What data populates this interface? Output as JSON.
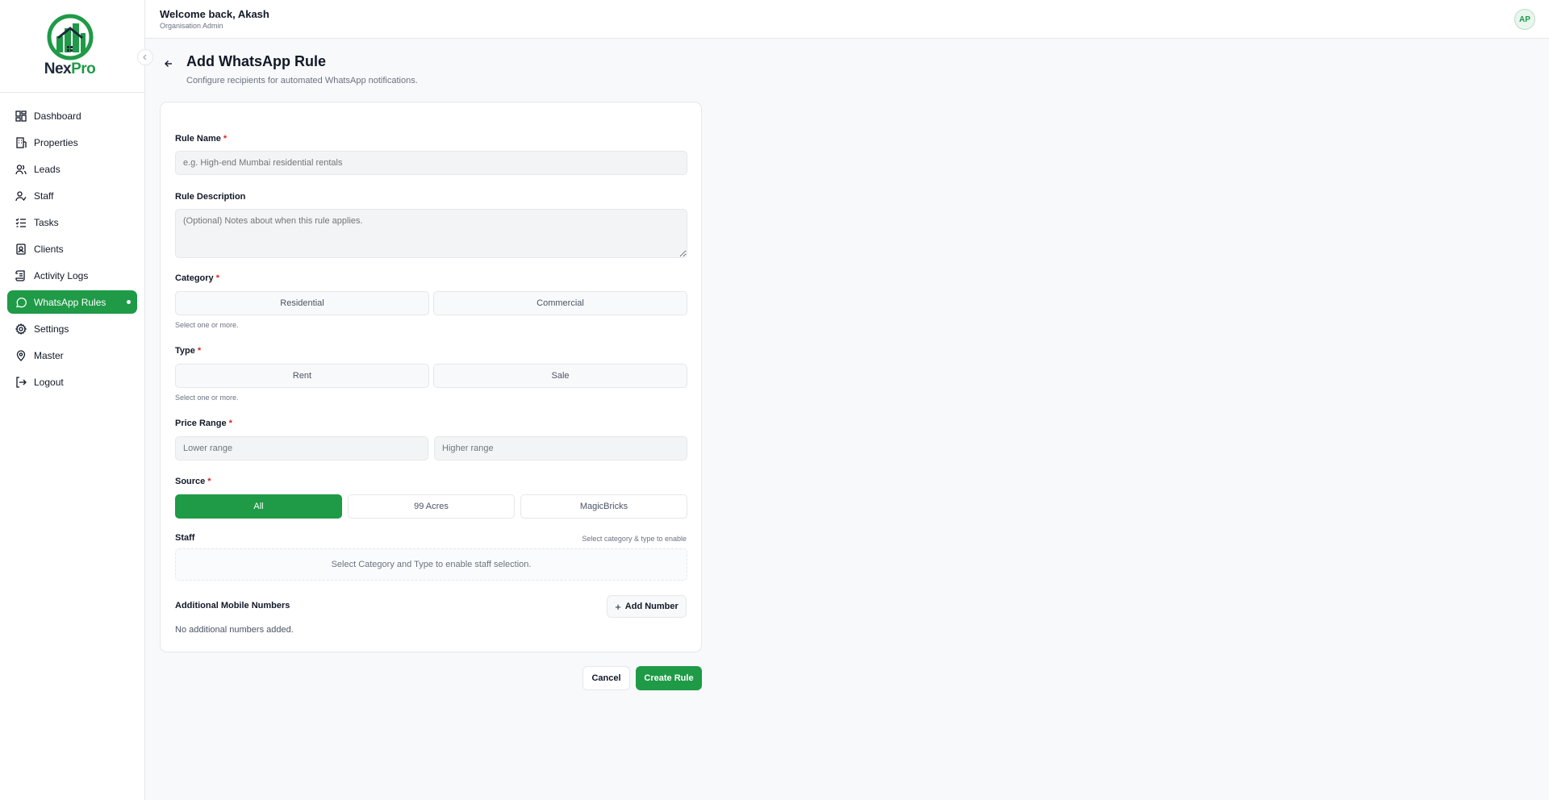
{
  "brand": {
    "name_part1": "Nex",
    "name_part2": "Pro",
    "accent_color": "#1f9a47"
  },
  "sidebar": {
    "collapse_icon": "chevron-left-icon",
    "items": [
      {
        "label": "Dashboard",
        "icon": "dashboard-icon",
        "active": false
      },
      {
        "label": "Properties",
        "icon": "building-icon",
        "active": false
      },
      {
        "label": "Leads",
        "icon": "users-icon",
        "active": false
      },
      {
        "label": "Staff",
        "icon": "user-check-icon",
        "active": false
      },
      {
        "label": "Tasks",
        "icon": "list-checks-icon",
        "active": false
      },
      {
        "label": "Clients",
        "icon": "contact-icon",
        "active": false
      },
      {
        "label": "Activity Logs",
        "icon": "scroll-icon",
        "active": false
      },
      {
        "label": "WhatsApp Rules",
        "icon": "message-circle-icon",
        "active": true
      },
      {
        "label": "Settings",
        "icon": "gear-icon",
        "active": false
      },
      {
        "label": "Master",
        "icon": "map-pin-icon",
        "active": false
      },
      {
        "label": "Logout",
        "icon": "logout-icon",
        "active": false
      }
    ]
  },
  "header": {
    "welcome": "Welcome back, Akash",
    "role": "Organisation Admin",
    "avatar_initials": "AP"
  },
  "page": {
    "title": "Add WhatsApp Rule",
    "subtitle": "Configure recipients for automated WhatsApp notifications."
  },
  "form": {
    "rule_name": {
      "label": "Rule Name",
      "required_mark": "*",
      "placeholder": "e.g. High-end Mumbai residential rentals",
      "value": ""
    },
    "rule_description": {
      "label": "Rule Description",
      "placeholder": "(Optional) Notes about when this rule applies.",
      "value": ""
    },
    "category": {
      "label": "Category",
      "required_mark": "*",
      "options": [
        "Residential",
        "Commercial"
      ],
      "hint": "Select one or more."
    },
    "type": {
      "label": "Type",
      "required_mark": "*",
      "options": [
        "Rent",
        "Sale"
      ],
      "hint": "Select one or more."
    },
    "price_range": {
      "label": "Price Range",
      "required_mark": "*",
      "lower_placeholder": "Lower range",
      "higher_placeholder": "Higher range"
    },
    "source": {
      "label": "Source",
      "required_mark": "*",
      "options": [
        "All",
        "99 Acres",
        "MagicBricks"
      ],
      "selected": "All"
    },
    "staff": {
      "label": "Staff",
      "hint": "Select category & type to enable",
      "empty_text": "Select Category and Type to enable staff selection."
    },
    "additional_numbers": {
      "label": "Additional Mobile Numbers",
      "add_button": "Add Number",
      "empty_text": "No additional numbers added."
    }
  },
  "actions": {
    "cancel": "Cancel",
    "create": "Create Rule"
  }
}
